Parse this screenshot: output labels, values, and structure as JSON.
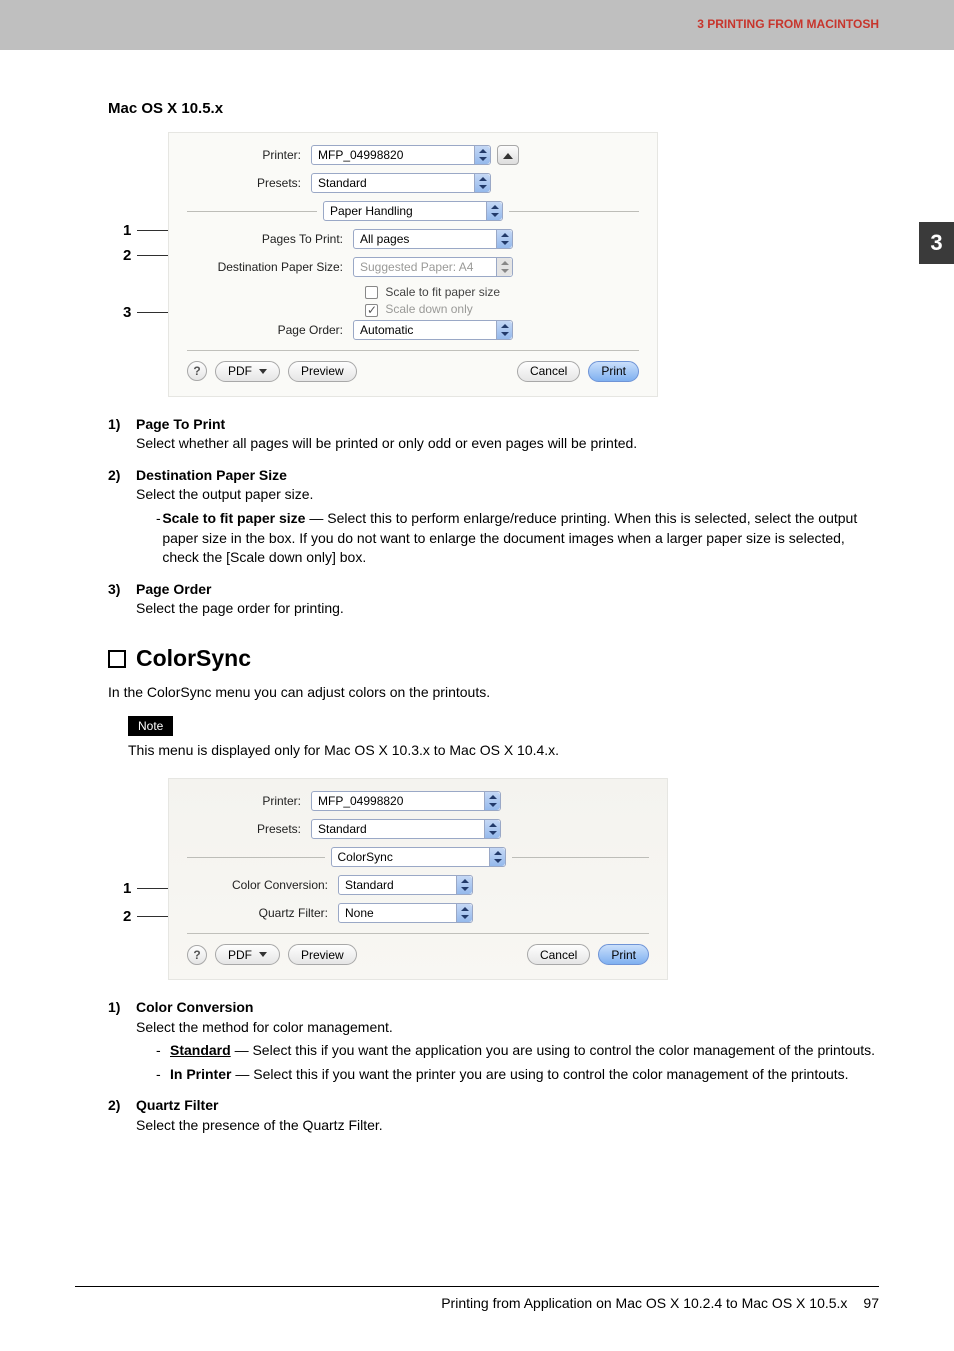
{
  "header": {
    "chapter_label": "3 PRINTING FROM MACINTOSH",
    "chapter_tab": "3"
  },
  "section1": {
    "heading": "Mac OS X 10.5.x",
    "dialog": {
      "printer_label": "Printer:",
      "printer_value": "MFP_04998820",
      "presets_label": "Presets:",
      "presets_value": "Standard",
      "pane_value": "Paper Handling",
      "pages_label": "Pages To Print:",
      "pages_value": "All pages",
      "dest_label": "Destination Paper Size:",
      "dest_value": "Suggested Paper: A4",
      "scale_fit": "Scale to fit paper size",
      "scale_down": "Scale down only",
      "order_label": "Page Order:",
      "order_value": "Automatic",
      "pdf_btn": "PDF",
      "preview_btn": "Preview",
      "cancel_btn": "Cancel",
      "print_btn": "Print"
    },
    "callouts": [
      "1",
      "2",
      "3"
    ],
    "desc": [
      {
        "num": "1)",
        "title": "Page To Print",
        "text": "Select whether all pages will be printed or only odd or even pages will be printed."
      },
      {
        "num": "2)",
        "title": "Destination Paper Size",
        "text": "Select the output paper size.",
        "sub": [
          {
            "bold": "Scale to fit paper size",
            "rest": " — Select this to perform enlarge/reduce printing.  When this is selected, select the output paper size in the box.  If you do not want to enlarge the document images when a larger paper size is selected, check the [Scale down only] box."
          }
        ]
      },
      {
        "num": "3)",
        "title": "Page Order",
        "text": "Select the page order for printing."
      }
    ]
  },
  "section2": {
    "heading": "ColorSync",
    "intro": "In the ColorSync menu you can adjust colors on the printouts.",
    "note_label": "Note",
    "note_text": "This menu is displayed only for Mac OS X 10.3.x to Mac OS X 10.4.x.",
    "dialog": {
      "printer_label": "Printer:",
      "printer_value": "MFP_04998820",
      "presets_label": "Presets:",
      "presets_value": "Standard",
      "pane_value": "ColorSync",
      "cc_label": "Color Conversion:",
      "cc_value": "Standard",
      "qf_label": "Quartz Filter:",
      "qf_value": "None",
      "pdf_btn": "PDF",
      "preview_btn": "Preview",
      "cancel_btn": "Cancel",
      "print_btn": "Print"
    },
    "callouts": [
      "1",
      "2"
    ],
    "desc": [
      {
        "num": "1)",
        "title": "Color Conversion",
        "text": "Select the method for color management.",
        "sub": [
          {
            "bold": "Standard",
            "underline": true,
            "rest": " — Select this if you want the application you are using to control the color management of the printouts."
          },
          {
            "bold": "In Printer",
            "rest": " — Select this if you want the printer you are using to control the color management of the printouts."
          }
        ]
      },
      {
        "num": "2)",
        "title": "Quartz Filter",
        "text": "Select the presence of the Quartz Filter."
      }
    ]
  },
  "footer": {
    "text": "Printing from Application on Mac OS X 10.2.4 to Mac OS X 10.5.x",
    "page": "97"
  }
}
